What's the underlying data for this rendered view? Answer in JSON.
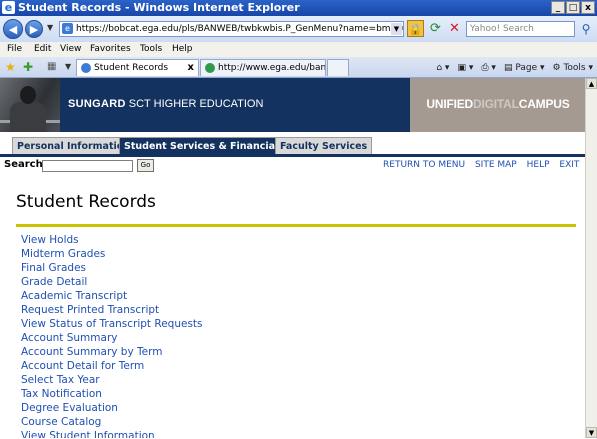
{
  "window": {
    "title": "Student Records - Windows Internet Explorer",
    "min": "_",
    "max": "□",
    "close": "x"
  },
  "address": {
    "url": "https://bobcat.ega.edu/pls/BANWEB/twbkwbis.P_GenMenu?name=bmenu.P_AdminMnu",
    "search_placeholder": "Yahoo! Search"
  },
  "menubar": [
    "File",
    "Edit",
    "View",
    "Favorites",
    "Tools",
    "Help"
  ],
  "browser_tabs": [
    {
      "label": "Student Records",
      "active": true,
      "close": "x"
    },
    {
      "label": "http://www.ega.edu/banner...",
      "active": false
    }
  ],
  "commandbar": {
    "page": "Page",
    "tools": "Tools"
  },
  "banner": {
    "brand_bold": "SUNGARD",
    "brand_rest": " SCT HIGHER EDUCATION",
    "udc_1": "UNIFIED",
    "udc_2": "DIGITAL",
    "udc_3": "CAMPUS"
  },
  "site_tabs": [
    {
      "label": "Personal Information",
      "active": false
    },
    {
      "label": "Student Services & Financial Aid",
      "active": true
    },
    {
      "label": "Faculty Services",
      "active": false
    }
  ],
  "search": {
    "label": "Search",
    "go": "Go"
  },
  "top_links": [
    "RETURN TO MENU",
    "SITE MAP",
    "HELP",
    "EXIT"
  ],
  "page_title": "Student Records",
  "links": [
    "View Holds",
    "Midterm Grades",
    "Final Grades",
    "Grade Detail",
    "Academic Transcript",
    "Request Printed Transcript",
    "View Status of Transcript Requests",
    "Account Summary",
    "Account Summary by Term",
    "Account Detail for Term",
    "Select Tax Year",
    "Tax Notification",
    "Degree Evaluation",
    "Course Catalog",
    "View Student Information"
  ],
  "colors": {
    "banner_navy": "#14325f",
    "link_blue": "#1f4fb3",
    "rule_gold": "#c8c200",
    "banner_taupe": "#a59a92"
  }
}
